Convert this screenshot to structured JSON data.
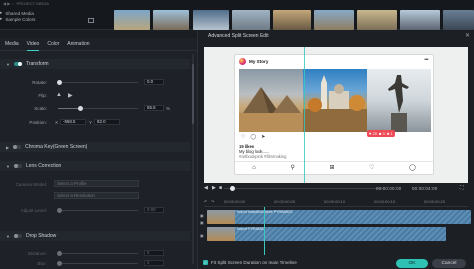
{
  "media": {
    "crumb": "◀ ▶ ← PROJECT MEDIA",
    "library": [
      "Shared Media",
      "Sample Colors"
    ]
  },
  "left_panel": {
    "tabs": [
      "Media",
      "Video",
      "Color",
      "Animation"
    ],
    "active_tab": "Video",
    "transform": {
      "label": "Transform",
      "rotate_label": "Rotate:",
      "rotate_value": "0.0",
      "flip_label": "Flip:",
      "scale_label": "Scale:",
      "scale_value": "55.5",
      "scale_unit": "%",
      "scale_fraction": 0.28,
      "position_label": "Position:",
      "x_label": "X",
      "x_value": "-558.5",
      "y_label": "Y",
      "y_value": "82.0"
    },
    "chroma_key": {
      "label": "Chroma Key(Green Screen)"
    },
    "lens_correction": {
      "label": "Lens Correction",
      "camera_model_label": "Camera Model:",
      "camera_model_placeholder": "Select a Profile",
      "resolution_placeholder": "Select a Resolution",
      "adjust_label": "Adjust Level:",
      "adjust_value": "0.00"
    },
    "drop_shadow": {
      "label": "Drop Shadow",
      "distance_label": "Distance:",
      "distance_value": "0",
      "blur_label": "Blur:",
      "blur_value": "0"
    }
  },
  "dialog": {
    "title": "Advanced Split Screen Edit",
    "close": "✕",
    "post": {
      "username": "My Story",
      "more": "•••",
      "likes": "15 likes",
      "caption": "My blog look......",
      "subcaption": "#artbookpink #filmmaking",
      "hashtag": "#"
    },
    "notify": {
      "hearts": "♥ 20",
      "comments": "■ 3",
      "follows": "♣ 1"
    },
    "transport": {
      "timecode_current": "00:00:00:00",
      "timecode_total": "00:00:04:00",
      "zoom_tc": "00:00:02:00"
    },
    "ruler": [
      "00:00:00:00",
      "00:00:00:05",
      "00:00:00:10",
      "00:00:00:15",
      "00:00:00:20"
    ],
    "tracks": [
      {
        "name": "import beautiful/nature PYRAMIDS",
        "thumb": "pyramids"
      },
      {
        "name": "Import PYRAMID",
        "thumb": "pyramids"
      }
    ],
    "footer": {
      "checkbox_label": "Fit Split Screen Duration on main Timeline",
      "ok": "OK",
      "cancel": "Cancel"
    }
  }
}
